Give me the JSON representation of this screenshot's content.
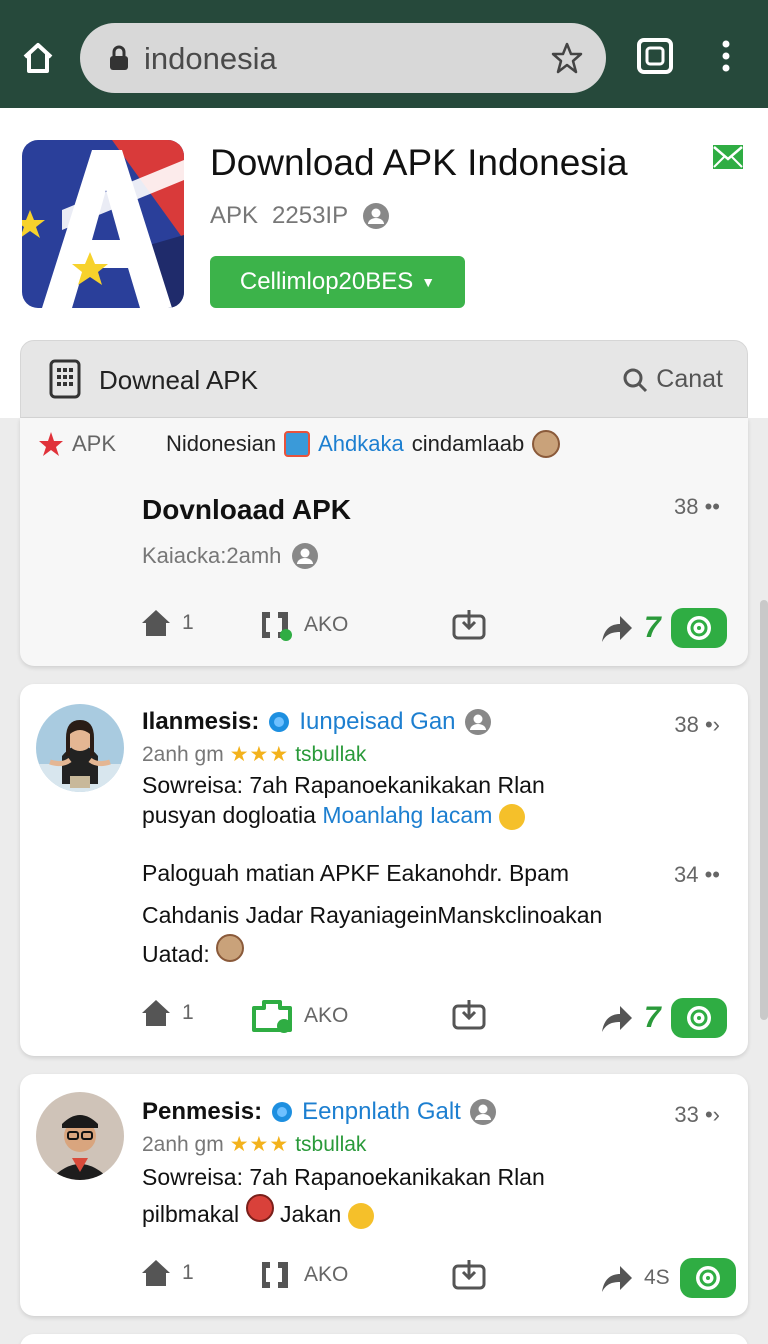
{
  "browser": {
    "url": "indonesia",
    "colors": {
      "bar": "#26493b",
      "url_box": "#d8d8d8"
    },
    "icons": [
      "home-icon",
      "lock-icon",
      "star-icon",
      "tabs-icon",
      "menu-icon"
    ]
  },
  "app": {
    "title": "Download APK Indonesia",
    "meta_label": "APK",
    "meta_value": "2253IP",
    "install_label": "Cellimlop20BES",
    "accent": "#3cb34a"
  },
  "section": {
    "title": "Downeal APK",
    "search_label": "Canat"
  },
  "cards": [
    {
      "tag_apk": "APK",
      "tag_text": "Nidonesian",
      "tag_link": "Ahdkakа",
      "tag_tail": "cindamlaab",
      "title": "Dovnloaad APK",
      "subtitle": "Kaiacka:2amh",
      "count": "38",
      "actions": {
        "like": "1",
        "repost": "AKO",
        "share": "7"
      }
    },
    {
      "author": "Ilanmesis:",
      "handle": "Iunpeisad Gan",
      "count": "38",
      "time": "2anh gm",
      "stars": "★★★",
      "meta_tag": "tsbullak",
      "body_1": "Sowreisa: 7ah Rapanoekanikakan Rlan",
      "body_2_text": "pusyan dogloatia",
      "body_2_link": "Moanlahg Iacam",
      "body_3": "Paloguah matian APKF Eakanohdr. Bpam",
      "count_2": "34",
      "body_4": "Cahdanis Jadar RayaniageinManskclinoakan",
      "body_5": "Uatad:",
      "actions": {
        "like": "1",
        "repost": "AKO",
        "share": "7"
      }
    },
    {
      "author": "Penmesis:",
      "handle": "Eenpnlath Galt",
      "count": "33",
      "time": "2anh gm",
      "stars": "★★★",
      "meta_tag": "tsbullak",
      "body_1": "Sowreisa: 7ah Rapanoekanikakan Rlan",
      "body_2_text": "pilbmakal",
      "body_2_tail": "Jakan",
      "actions": {
        "like": "1",
        "repost": "AKO",
        "share": "4S"
      }
    }
  ]
}
